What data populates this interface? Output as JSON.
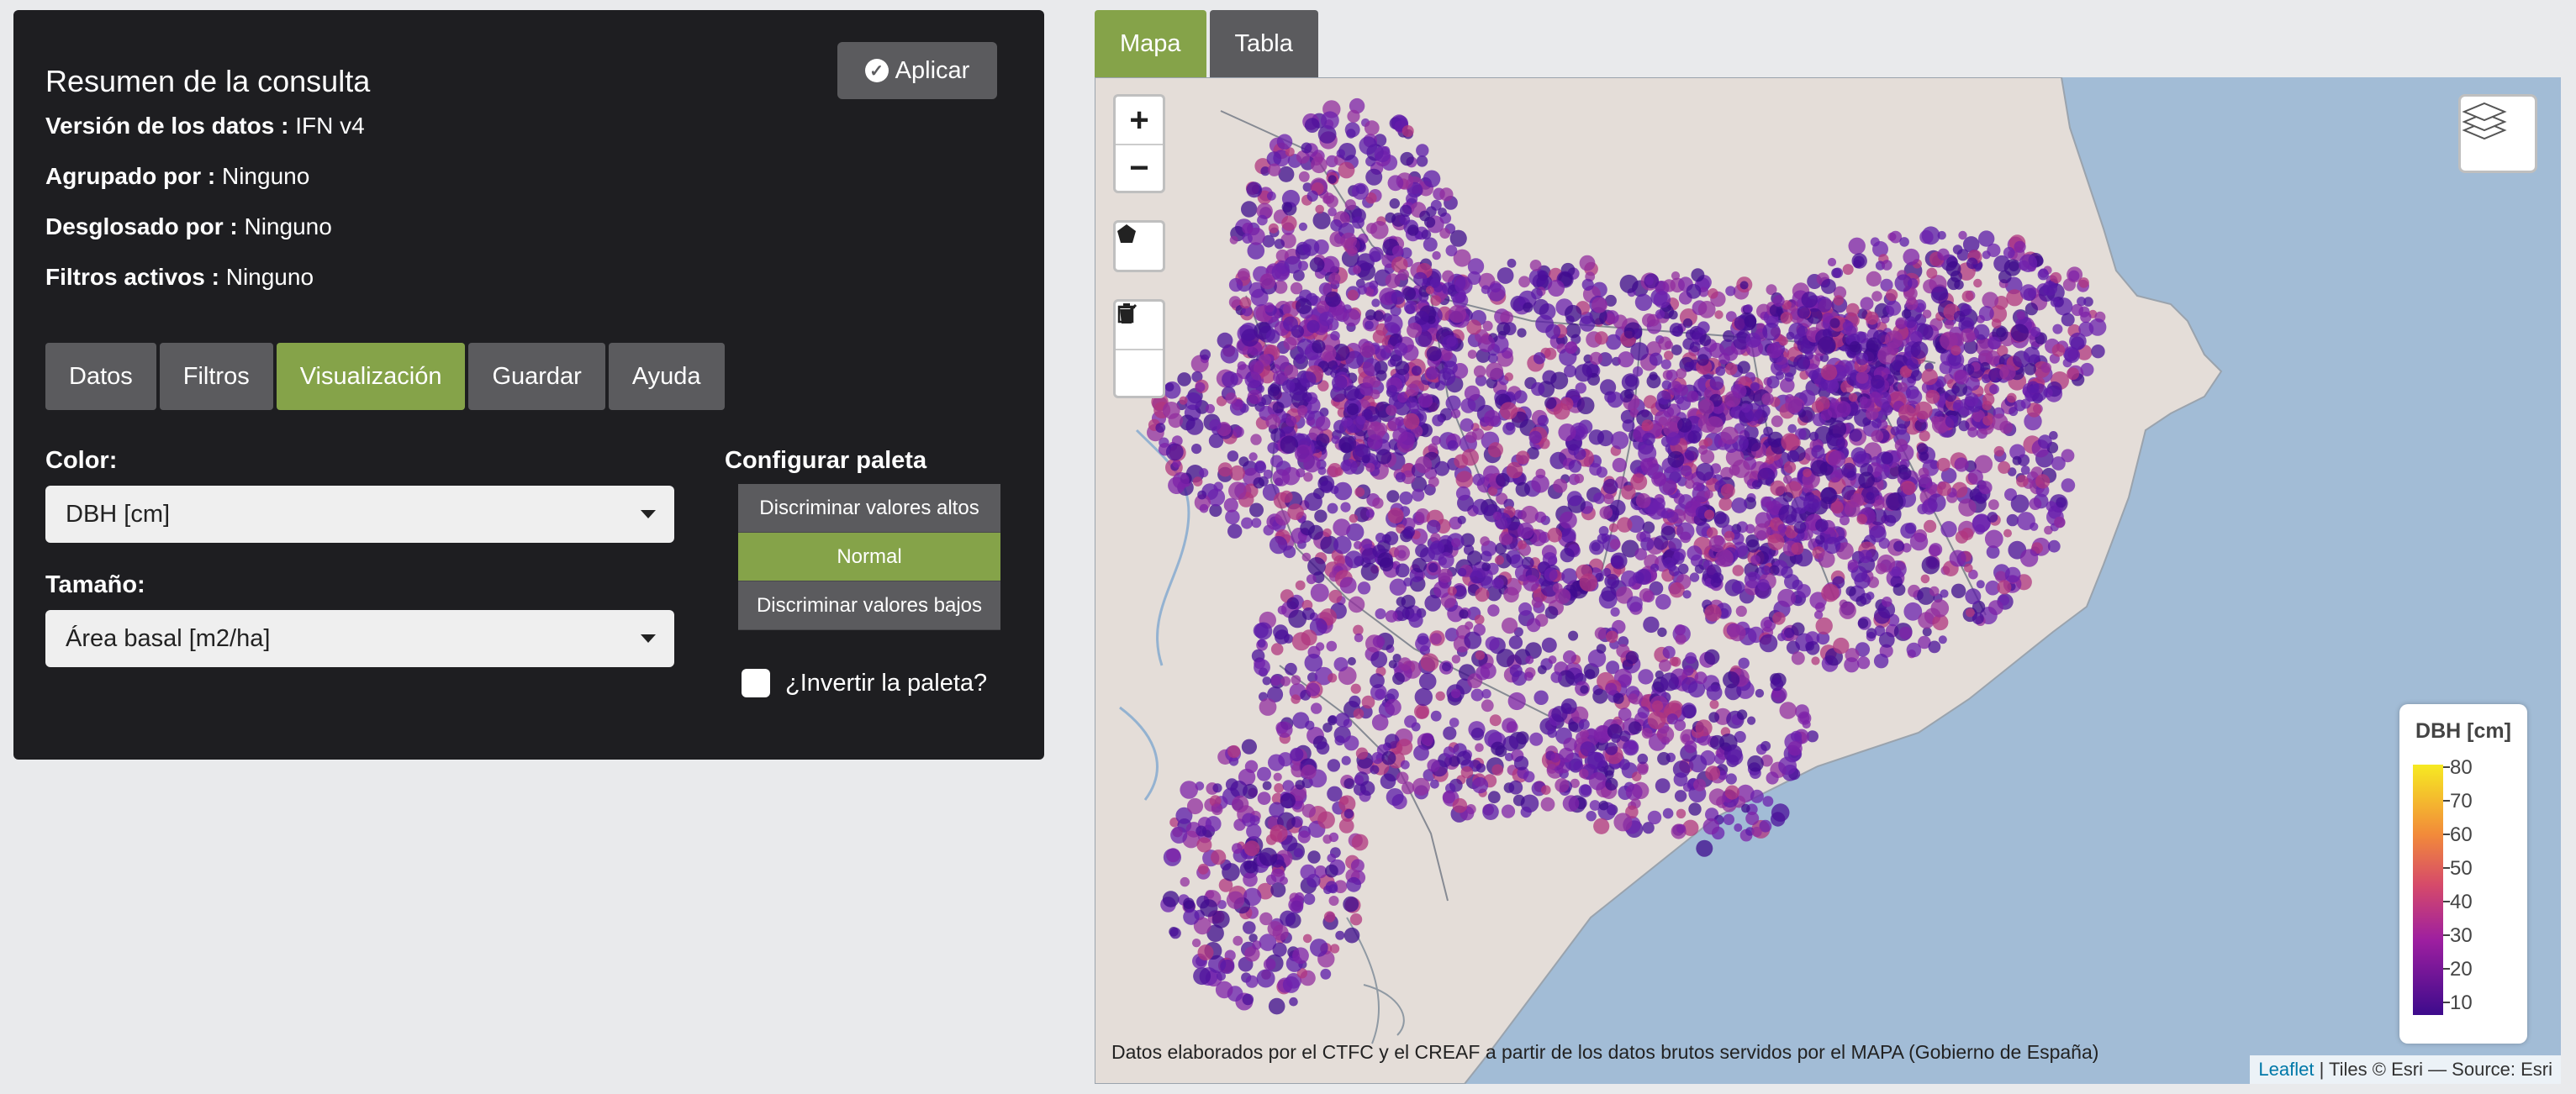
{
  "summary": {
    "title": "Resumen de la consulta",
    "apply_label": "Aplicar",
    "lines": [
      {
        "label": "Versión de los datos :",
        "value": "IFN v4"
      },
      {
        "label": "Agrupado por :",
        "value": "Ninguno"
      },
      {
        "label": "Desglosado por :",
        "value": "Ninguno"
      },
      {
        "label": "Filtros activos :",
        "value": "Ninguno"
      }
    ]
  },
  "tabs": [
    {
      "label": "Datos",
      "active": false
    },
    {
      "label": "Filtros",
      "active": false
    },
    {
      "label": "Visualización",
      "active": true
    },
    {
      "label": "Guardar",
      "active": false
    },
    {
      "label": "Ayuda",
      "active": false
    }
  ],
  "visualization": {
    "color_label": "Color:",
    "color_value": "DBH [cm]",
    "size_label": "Tamaño:",
    "size_value": "Área basal [m2/ha]",
    "palette_label": "Configurar paleta",
    "palette_options": [
      {
        "label": "Discriminar valores altos",
        "active": false
      },
      {
        "label": "Normal",
        "active": true
      },
      {
        "label": "Discriminar valores bajos",
        "active": false
      }
    ],
    "invert_label": "¿Invertir la paleta?",
    "invert_checked": false
  },
  "map_tabs": [
    {
      "label": "Mapa",
      "active": true
    },
    {
      "label": "Tabla",
      "active": false
    }
  ],
  "map": {
    "zoom_in": "+",
    "zoom_out": "−",
    "legend": {
      "title": "DBH [cm]",
      "ticks": [
        "80",
        "70",
        "60",
        "50",
        "40",
        "30",
        "20",
        "10"
      ]
    },
    "attribution_main": "Datos elaborados por el CTFC y el CREAF a partir de los datos brutos servidos por el MAPA (Gobierno de España)",
    "attribution_link": "Leaflet",
    "attribution_rest": " | Tiles © Esri — Source: Esri",
    "colors": {
      "land": "#e4ddd8",
      "sea": "#a2bcd6",
      "point": "#5b1aa8",
      "accent": "#85a349"
    }
  }
}
